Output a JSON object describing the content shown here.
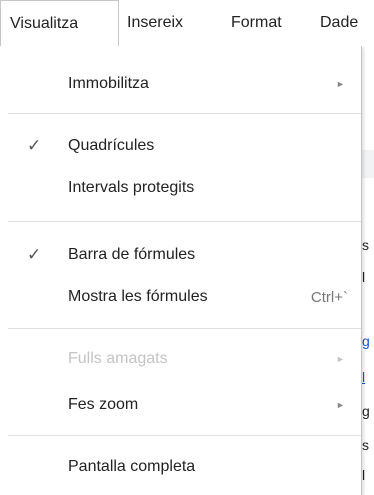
{
  "menubar": {
    "items": [
      {
        "label": "Visualitza"
      },
      {
        "label": "Insereix"
      },
      {
        "label": "Format"
      },
      {
        "label": "Dade"
      }
    ]
  },
  "dropdown": {
    "items": [
      {
        "label": "Immobilitza",
        "submenu": true,
        "checked": false,
        "disabled": false
      },
      {
        "label": "Quadrícules",
        "submenu": false,
        "checked": true,
        "disabled": false
      },
      {
        "label": "Intervals protegits",
        "submenu": false,
        "checked": false,
        "disabled": false
      },
      {
        "label": "Barra de fórmules",
        "submenu": false,
        "checked": true,
        "disabled": false
      },
      {
        "label": "Mostra les fórmules",
        "shortcut": "Ctrl+`",
        "submenu": false,
        "checked": false,
        "disabled": false
      },
      {
        "label": "Fulls amagats",
        "submenu": true,
        "checked": false,
        "disabled": true
      },
      {
        "label": "Fes zoom",
        "submenu": true,
        "checked": false,
        "disabled": false
      },
      {
        "label": "Pantalla completa",
        "submenu": false,
        "checked": false,
        "disabled": false
      }
    ],
    "check_glyph": "✓",
    "submenu_glyph": "►"
  },
  "sheet": {
    "fragments": [
      "s",
      "l",
      "g",
      "l",
      "g",
      "s",
      "l"
    ]
  },
  "colors": {
    "text": "#222222",
    "disabled_text": "#c4c4c4",
    "menu_border": "#c6c6c6",
    "separator": "#e0e0e0",
    "link": "#1155cc"
  }
}
